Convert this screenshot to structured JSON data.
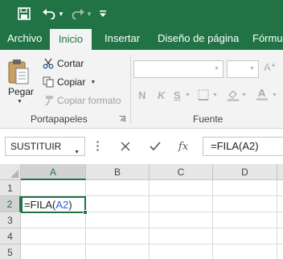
{
  "quick_access": {
    "icons": [
      "save-icon",
      "undo-icon",
      "redo-icon",
      "customize-icon"
    ]
  },
  "tabs": [
    {
      "label": "Archivo",
      "active": false
    },
    {
      "label": "Inicio",
      "active": true
    },
    {
      "label": "Insertar",
      "active": false
    },
    {
      "label": "Diseño de página",
      "active": false
    },
    {
      "label": "Fórmul",
      "active": false
    }
  ],
  "ribbon": {
    "clipboard": {
      "paste_label": "Pegar",
      "cut_label": "Cortar",
      "copy_label": "Copiar",
      "format_painter_label": "Copiar formato",
      "group_label": "Portapapeles"
    },
    "font": {
      "font_name": "",
      "font_size": "",
      "bold": "N",
      "italic": "K",
      "underline": "S",
      "group_label": "Fuente"
    }
  },
  "formula_bar": {
    "name_box": "SUSTITUIR",
    "fx_label": "fx",
    "formula": "=FILA(A2)"
  },
  "grid": {
    "columns": [
      "A",
      "B",
      "C",
      "D"
    ],
    "rows": [
      "1",
      "2",
      "3",
      "4",
      "5"
    ],
    "selected_column": "A",
    "selected_row": "2",
    "active_cell": {
      "prefix": "=FILA(",
      "ref": "A2",
      "suffix": ")"
    }
  },
  "colors": {
    "accent": "#217346",
    "reference": "#2e5fd6"
  }
}
